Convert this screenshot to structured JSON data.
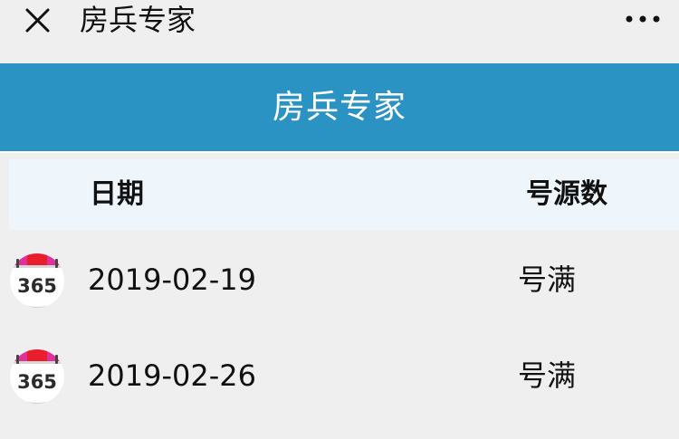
{
  "topbar": {
    "close_icon": "close-icon",
    "title": "房兵专家",
    "more_icon": "more-horizontal-icon"
  },
  "header": {
    "title": "房兵专家",
    "background_color": "#2b93c3"
  },
  "table": {
    "columns": [
      "日期",
      "号源数"
    ],
    "rows": [
      {
        "icon": "calendar-365-icon",
        "icon_text": "365",
        "date": "2019-02-19",
        "status": "号满"
      },
      {
        "icon": "calendar-365-icon",
        "icon_text": "365",
        "date": "2019-02-26",
        "status": "号满"
      }
    ]
  }
}
